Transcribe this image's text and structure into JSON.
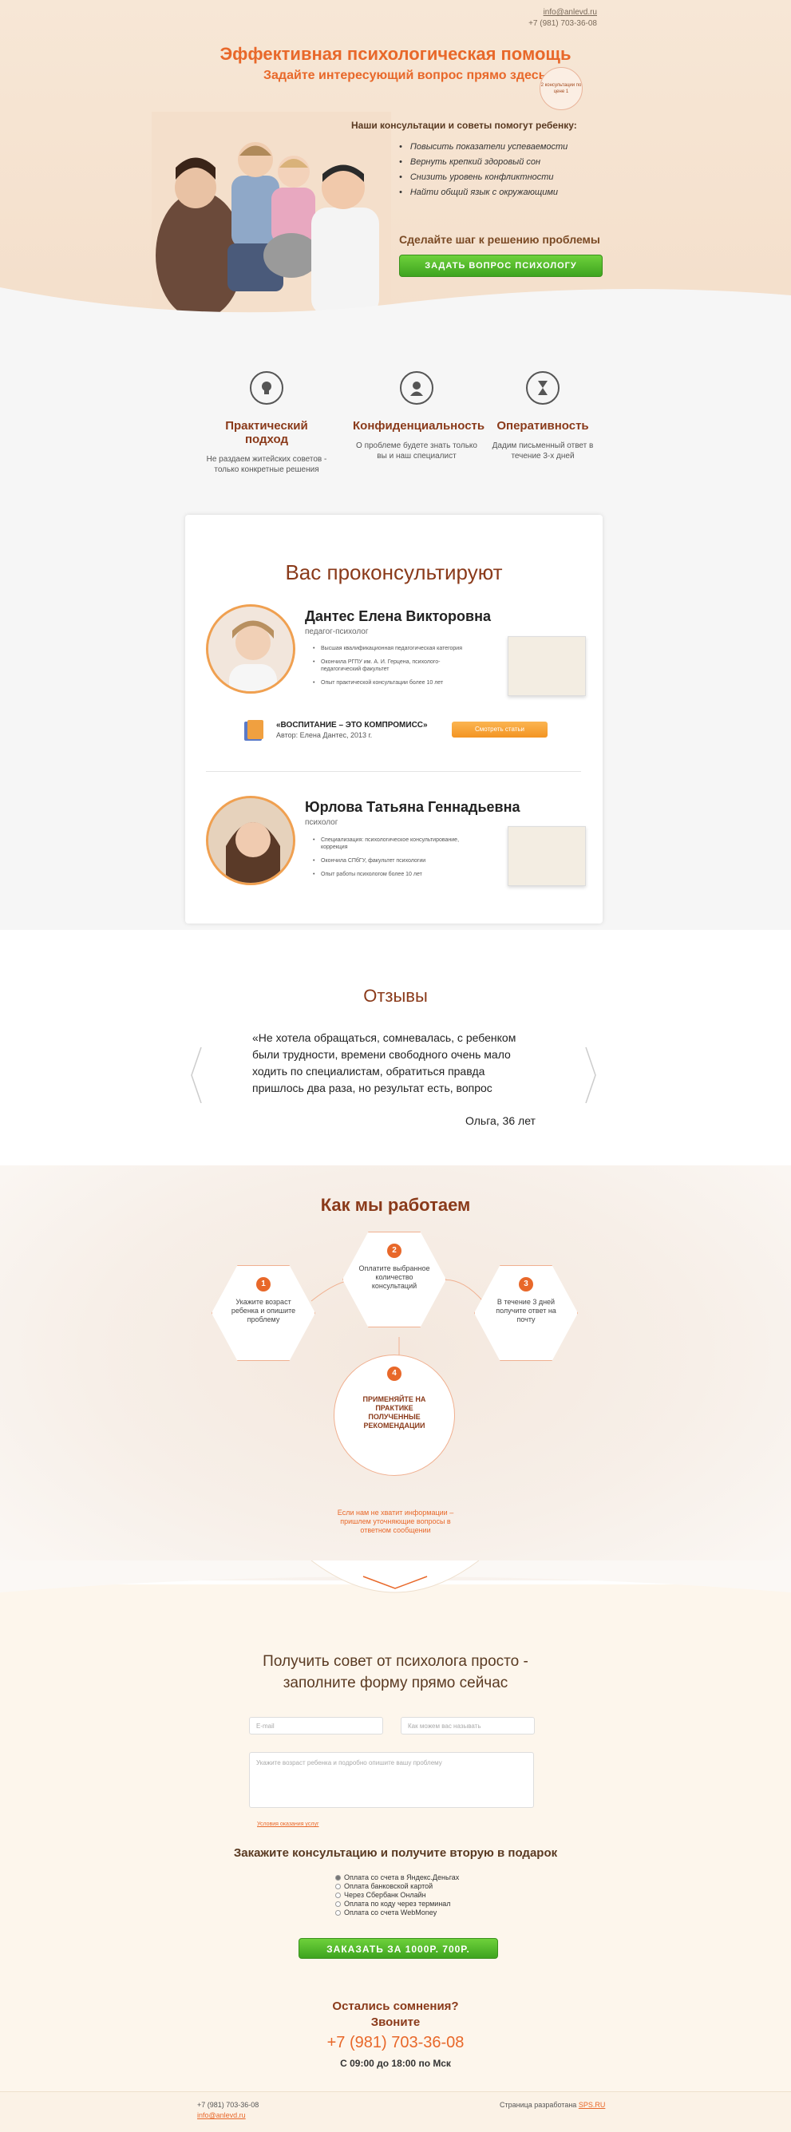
{
  "header": {
    "email": "info@anlevd.ru",
    "phone": "+7 (981) 703-36-08",
    "title": "Эффективная психологическая помощь",
    "subtitle": "Задайте интересующий вопрос прямо здесь",
    "badge": "2 консультации по цене 1"
  },
  "hero": {
    "help_heading": "Наши консультации и советы помогут ребенку:",
    "help_items": [
      "Повысить показатели успеваемости",
      "Вернуть крепкий здоровый сон",
      "Снизить уровень конфликтности",
      "Найти общий язык с окружающими"
    ],
    "step_text": "Сделайте шаг к решению проблемы",
    "cta_label": "ЗАДАТЬ ВОПРОС ПСИХОЛОГУ"
  },
  "features": [
    {
      "icon": "lightbulb-icon",
      "title": "Практический подход",
      "desc": "Не раздаем житейских советов - только конкретные решения"
    },
    {
      "icon": "user-icon",
      "title": "Конфиденциальность",
      "desc": "О проблеме будете знать только вы и наш специалист"
    },
    {
      "icon": "hourglass-icon",
      "title": "Оперативность",
      "desc": "Дадим письменный ответ в течение 3-х дней"
    }
  ],
  "specialists": {
    "title": "Вас проконсультируют",
    "items": [
      {
        "name": "Дантес Елена Викторовна",
        "role": "педагог-психолог",
        "facts": [
          "Высшая квалификационная педагогическая категория",
          "Окончила РГПУ им. А. И. Герцена, психолого-педагогический факультет",
          "Опыт практической консультации более 10 лет"
        ]
      },
      {
        "name": "Юрлова Татьяна Геннадьевна",
        "role": "психолог",
        "facts": [
          "Специализация: психологическое консультирование, коррекция",
          "Окончила СПбГУ, факультет психологии",
          "Опыт работы психологом более 10 лет"
        ]
      }
    ],
    "book": {
      "title": "«ВОСПИТАНИЕ – ЭТО КОМПРОМИСС»",
      "author": "Автор: Елена Дантес, 2013 г.",
      "button": "Смотреть статьи"
    }
  },
  "reviews": {
    "title": "Отзывы",
    "text": "«Не хотела обращаться, сомневалась, с ребенком были трудности, времени свободного очень мало ходить по специалистам, обратиться правда пришлось два раза, но результат есть, вопрос",
    "author": "Ольга, 36 лет"
  },
  "how": {
    "title": "Как мы работаем",
    "steps": [
      {
        "num": "1",
        "text": "Укажите возраст ребенка и опишите проблему"
      },
      {
        "num": "2",
        "text": "Оплатите выбранное количество консультаций"
      },
      {
        "num": "3",
        "text": "В течение 3 дней получите ответ на почту"
      },
      {
        "num": "4",
        "text": "ПРИМЕНЯЙТЕ НА ПРАКТИКЕ ПОЛУЧЕННЫЕ РЕКОМЕНДАЦИИ"
      }
    ],
    "note": "Если нам не хватит информации – пришлем уточняющие вопросы в ответном сообщении"
  },
  "form": {
    "title_line1": "Получить совет от психолога просто -",
    "title_line2": "заполните форму прямо сейчас",
    "email_placeholder": "E-mail",
    "name_placeholder": "Как можем вас называть",
    "message_placeholder": "Укажите возраст ребенка и подробно опишите вашу проблему",
    "terms": "Условия оказания услуг",
    "order_title": "Закажите консультацию и получите вторую в подарок",
    "payments": [
      "Оплата со счета в Яндекс.Деньгах",
      "Оплата банковской картой",
      "Через Сбербанк Онлайн",
      "Оплата по коду через терминал",
      "Оплата со счета WebMoney"
    ],
    "order_button": "ЗАКАЗАТЬ ЗА 1000Р. 700Р.",
    "doubt_line1": "Остались сомнения?",
    "doubt_line2": "Звоните",
    "phone": "+7 (981) 703-36-08",
    "hours": "С 09:00 до 18:00 по Мск"
  },
  "footer": {
    "phone": "+7 (981) 703-36-08",
    "email": "info@anlevd.ru",
    "dev_label": "Страница разработана",
    "dev_link": "SPS.RU"
  },
  "colors": {
    "accent": "#e8682a",
    "heading": "#8a3a1a",
    "cta": "#4fb427"
  }
}
